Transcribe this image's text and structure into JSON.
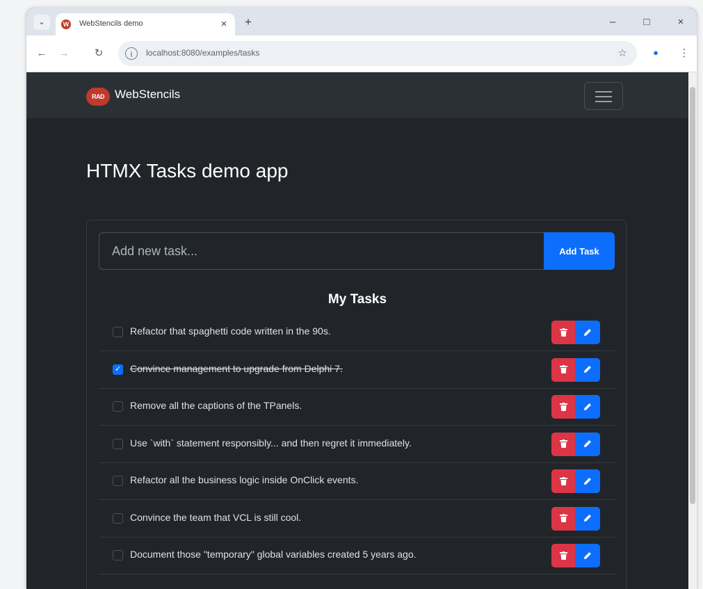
{
  "browser": {
    "tab_title": "WebStencils demo",
    "tab_favicon_letter": "W",
    "url": "localhost:8080/examples/tasks",
    "icons": [
      "tab-search-icon",
      "close-icon",
      "plus-icon",
      "minimize-icon",
      "maximize-icon",
      "close-window-icon",
      "back-arrow-icon",
      "forward-arrow-icon",
      "reload-icon",
      "site-info-icon",
      "star-icon",
      "profile-icon",
      "kebab-menu-icon"
    ]
  },
  "navbar": {
    "logo_text": "RAD",
    "brand": "WebStencils",
    "toggler_icon": "hamburger-icon"
  },
  "page": {
    "title": "HTMX Tasks demo app"
  },
  "form": {
    "placeholder": "Add new task...",
    "button_label": "Add Task"
  },
  "list": {
    "title": "My Tasks",
    "tasks": [
      {
        "text": "Refactor that spaghetti code written in the 90s.",
        "completed": false
      },
      {
        "text": "Convince management to upgrade from Delphi 7.",
        "completed": true
      },
      {
        "text": "Remove all the captions of the TPanels.",
        "completed": false
      },
      {
        "text": "Use `with` statement responsibly... and then regret it immediately.",
        "completed": false
      },
      {
        "text": "Refactor all the business logic inside OnClick events.",
        "completed": false
      },
      {
        "text": "Convince the team that VCL is still cool.",
        "completed": false
      },
      {
        "text": "Document those \"temporary\" global variables created 5 years ago.",
        "completed": false
      }
    ]
  },
  "colors": {
    "background": "#212529",
    "navbar": "#2b3035",
    "primary": "#0d6efd",
    "danger": "#dc3545"
  }
}
